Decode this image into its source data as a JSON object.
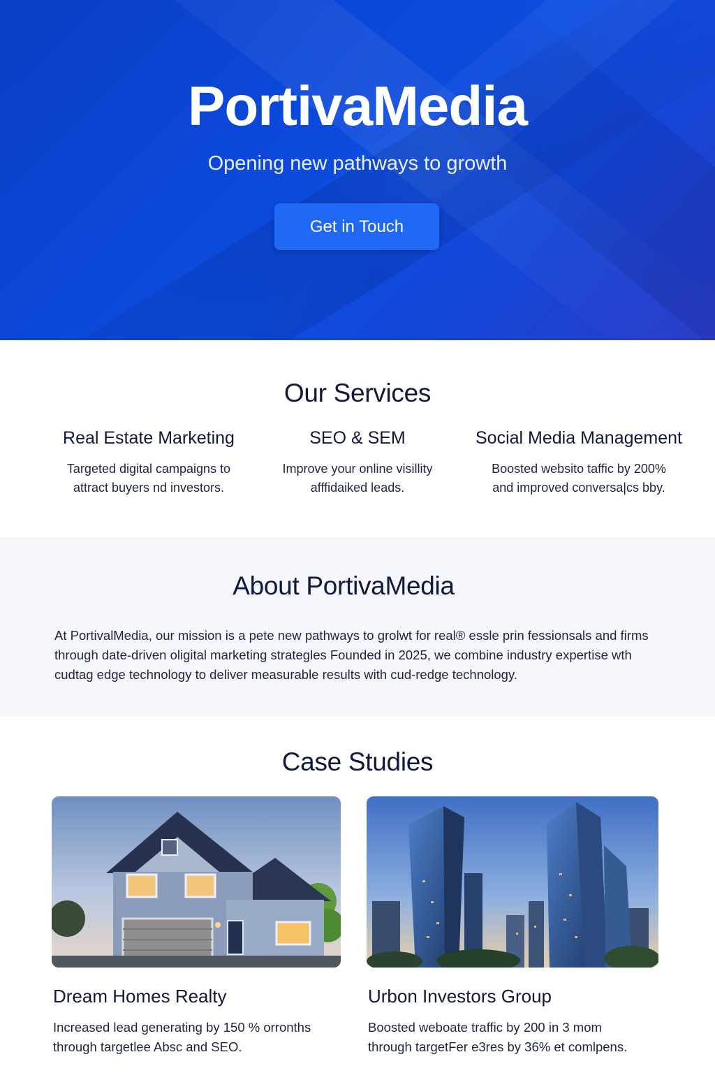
{
  "hero": {
    "title": "PortivaMedia",
    "tagline": "Opening new pathways to growth",
    "cta_label": "Get in Touch"
  },
  "services": {
    "title": "Our Services",
    "items": [
      {
        "title": "Real Estate Marketing",
        "line1": "Targeted digital campaigns to",
        "line2": "attract buyers nd investors."
      },
      {
        "title": "SEO & SEM",
        "line1": "Improve your online visillity",
        "line2": "afffidaiked leads."
      },
      {
        "title": "Social Media Management",
        "line1": "Boosted websito taffic by 200%",
        "line2": "and improved conversa|cs bby."
      }
    ]
  },
  "about": {
    "title": "About PortivaMedia",
    "line1": "At PortivalMedia, our mission is a pete new pathways to grolwt for real® essle prin fessionsals and firms",
    "line2": "through date-driven oligital marketing strategles Founded in 2025, we combine industry expertise wth",
    "line3": "cudtag edge technology to deliver measurable results with cud-redge technology."
  },
  "case_studies": {
    "title": "Case Studies",
    "items": [
      {
        "title": "Dream Homes Realty",
        "line1": "Increased lead generating by 150 % orronths",
        "line2": "through targetlee Absc and SEO.",
        "image": "suburban-house-photo"
      },
      {
        "title": "Urbon Investors Group",
        "line1": "Boosted weboate traffic by 200 in 3 mom",
        "line2": "through targetFer e3res by 36% et comlpens.",
        "image": "city-skyscrapers-photo"
      }
    ]
  },
  "colors": {
    "hero_blue": "#0b47d8",
    "cta_blue": "#2069f5",
    "heading_navy": "#0f1a3a",
    "about_bg": "#f5f7fc"
  }
}
